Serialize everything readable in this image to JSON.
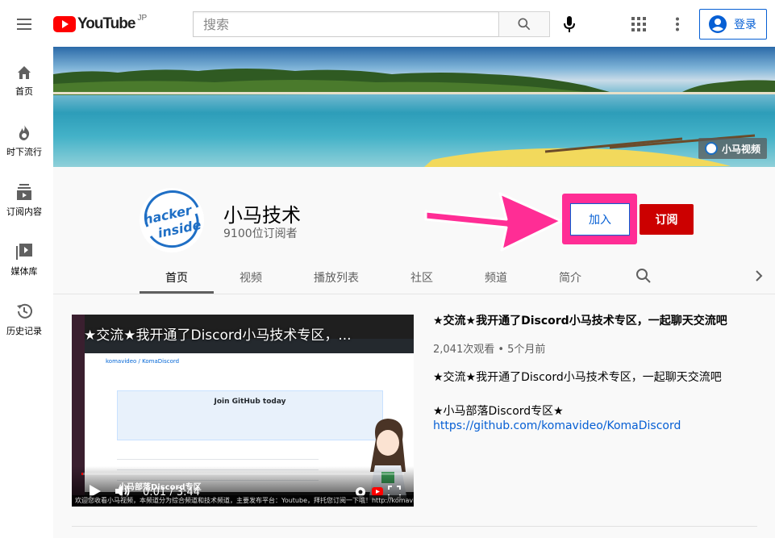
{
  "header": {
    "logo_text": "YouTube",
    "country": "JP",
    "search_placeholder": "搜索",
    "signin_label": "登录"
  },
  "sidebar": {
    "items": [
      {
        "label": "首页",
        "icon": "home-icon"
      },
      {
        "label": "时下流行",
        "icon": "trending-icon"
      },
      {
        "label": "订阅内容",
        "icon": "subscriptions-icon"
      },
      {
        "label": "媒体库",
        "icon": "library-icon"
      },
      {
        "label": "历史记录",
        "icon": "history-icon"
      }
    ]
  },
  "banner": {
    "badge_text": "小马视频"
  },
  "channel": {
    "name": "小马技术",
    "subscribers": "9100位订阅者",
    "avatar_text_line1": "hacker",
    "avatar_text_line2": "inside",
    "join_label": "加入",
    "subscribe_label": "订阅",
    "tabs": [
      "首页",
      "视频",
      "播放列表",
      "社区",
      "频道",
      "简介"
    ],
    "active_tab": "首页"
  },
  "featured_video": {
    "player_title": "★交流★我开通了Discord小马技术专区，...",
    "overlay_title": "小马部落Discord专区",
    "time": "0:01 / 3:44",
    "progress": 0.005,
    "repo_path": "komavideo / KomaDiscord",
    "join_banner": "Join GitHub today",
    "caption": "欢迎您收看小马视频，本频道分为综合频道和技术频道，主要发布平台：Youtube，拜托您订阅一下哦！http://komavideo.com",
    "title": "★交流★我开通了Discord小马技术专区，一起聊天交流吧",
    "meta": "2,041次观看 • 5个月前",
    "description_line1": "★交流★我开通了Discord小马技术专区，一起聊天交流吧",
    "description_line2": "★小马部落Discord专区★",
    "link": "https://github.com/komavideo/KomaDiscord"
  },
  "colors": {
    "brand_red": "#ff0000",
    "subscribe_red": "#cc0000",
    "link_blue": "#065fd4",
    "highlight_pink": "#ff2d95"
  }
}
